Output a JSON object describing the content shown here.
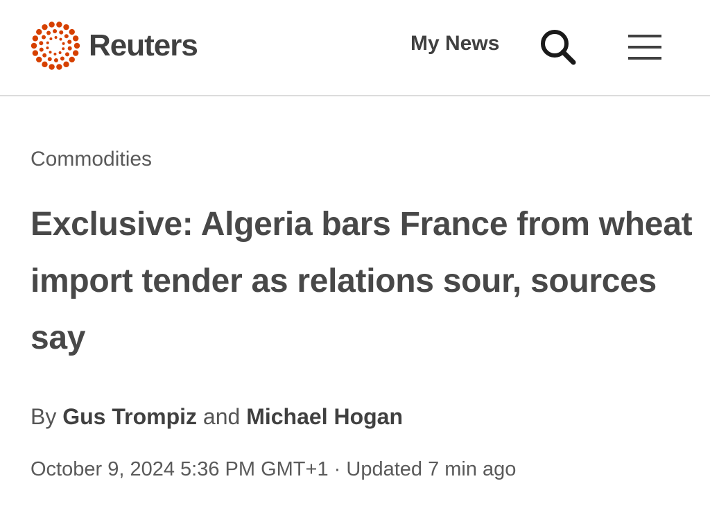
{
  "header": {
    "brand": "Reuters",
    "brand_color": "#d64000",
    "my_news_label": "My News",
    "search_icon": "search-icon",
    "menu_icon": "hamburger-menu-icon"
  },
  "article": {
    "section": "Commodities",
    "headline": "Exclusive: Algeria bars France from wheat import tender as relations sour, sources say",
    "byline": {
      "prefix": "By",
      "author1": "Gus Trompiz",
      "conjunction": "and",
      "author2": "Michael Hogan"
    },
    "date": "October 9, 2024 5:36 PM GMT+1",
    "separator": "·",
    "updated": "Updated 7 min ago"
  }
}
